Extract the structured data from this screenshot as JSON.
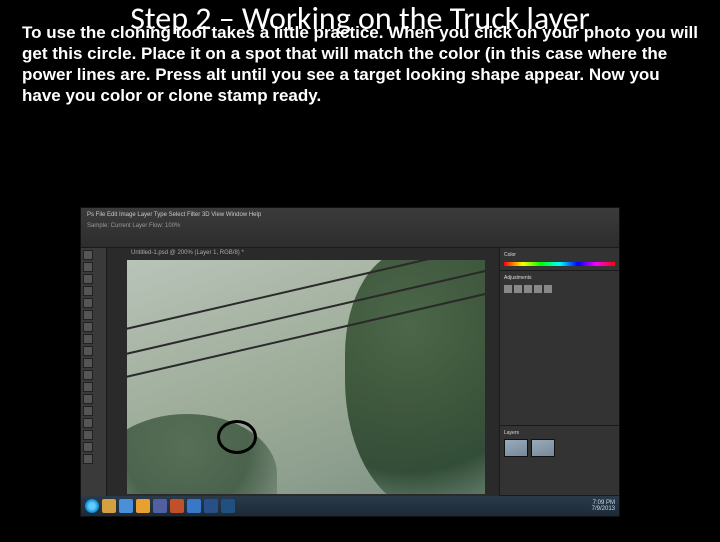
{
  "title": "Step 2 – Working on the Truck layer",
  "body": "To use the cloning tool takes a little practice. When you click on your photo you will get this circle. Place it on a spot that will match the color (in this case where the power lines are. Press alt until you see a target looking shape appear. Now you have you color or clone stamp ready.",
  "photoshop": {
    "menu": "Ps   File  Edit  Image  Layer  Type  Select  Filter  3D  View  Window  Help",
    "options_row": "Sample:  Current Layer            Flow: 100%",
    "tab": "Untitled-1.psd @ 200% (Layer 1, RGB/8) *",
    "panels": {
      "color": "Color",
      "adjustments": "Adjustments",
      "layers": "Layers"
    }
  },
  "taskbar": {
    "time": "7:09 PM",
    "date": "7/9/2013"
  }
}
